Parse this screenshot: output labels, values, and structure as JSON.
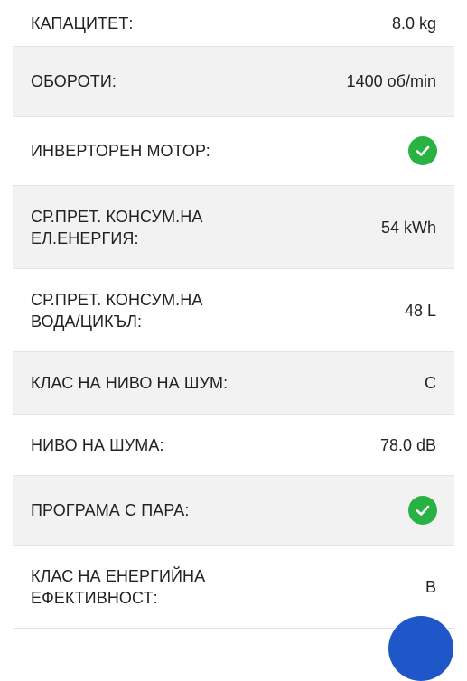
{
  "specs": [
    {
      "label": "КАПАЦИТЕТ:",
      "value": "8.0 kg"
    },
    {
      "label": "ОБОРОТИ:",
      "value": "1400 об/min"
    },
    {
      "label": "ИНВЕРТОРЕН МОТОР:",
      "icon": "checkmark-icon",
      "checked": true
    },
    {
      "label": "СР.ПРЕТ. КОНСУМ.НА ЕЛ.ЕНЕРГИЯ:",
      "value": "54 kWh"
    },
    {
      "label": "СР.ПРЕТ. КОНСУМ.НА ВОДА/ЦИКЪЛ:",
      "value": "48 L"
    },
    {
      "label": "КЛАС НА НИВО НА ШУМ:",
      "value": "C"
    },
    {
      "label": "НИВО НА ШУМА:",
      "value": "78.0 dB"
    },
    {
      "label": "ПРОГРАМА С ПАРА:",
      "icon": "checkmark-icon",
      "checked": true
    },
    {
      "label": "КЛАС НА ЕНЕРГИЙНА ЕФЕКТИВНОСТ:",
      "value": "B"
    }
  ],
  "colors": {
    "check": "#27b243",
    "row_alt": "#f2f2f2",
    "fab": "#1f57c9"
  }
}
